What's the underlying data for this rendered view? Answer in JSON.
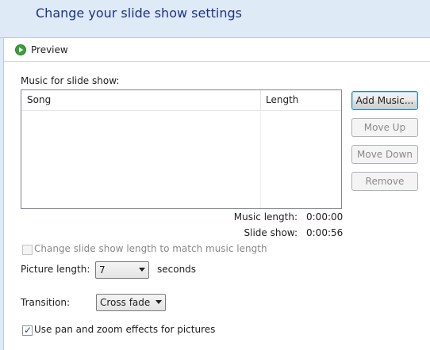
{
  "window": {
    "title": "Change your slide show settings"
  },
  "toolbar": {
    "preview_label": "Preview"
  },
  "music": {
    "section_label": "Music for slide show:",
    "columns": [
      "Song",
      "Length"
    ],
    "rows": []
  },
  "buttons": {
    "add_music": "Add Music...",
    "move_up": "Move Up",
    "move_down": "Move Down",
    "remove": "Remove"
  },
  "info": {
    "music_length_label": "Music length:",
    "music_length_value": "0:00:00",
    "slide_show_label": "Slide show:",
    "slide_show_value": "0:00:56"
  },
  "options": {
    "match_music_label": "Change slide show length to match music length",
    "match_music_checked": false,
    "match_music_enabled": false,
    "picture_length_label": "Picture length:",
    "picture_length_value": "7",
    "seconds_label": "seconds",
    "transition_label": "Transition:",
    "transition_value": "Cross fade",
    "pan_zoom_label": "Use pan and zoom effects for pictures",
    "pan_zoom_checked": true
  },
  "colors": {
    "header_bg": "#dfeaf7",
    "title_text": "#1e3287",
    "play_icon": "#3aa13a"
  },
  "icons": {
    "preview": "play-circle-icon"
  }
}
